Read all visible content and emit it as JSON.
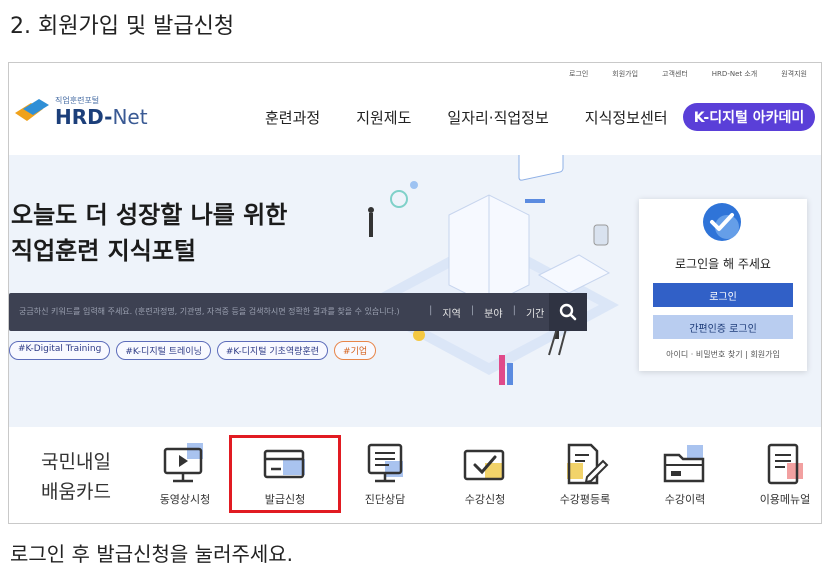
{
  "step_title": "2. 회원가입 및 발급신청",
  "caption": "로그인 후 발급신청을 눌러주세요.",
  "site": {
    "util_links": [
      "로그인",
      "회원가입",
      "고객센터",
      "HRD-Net 소개",
      "원격지원"
    ],
    "logo": {
      "sub": "직업훈련포털",
      "name": "HRD",
      "name_suffix": "Net"
    },
    "gnb": [
      "훈련과정",
      "지원제도",
      "일자리·직업정보",
      "지식정보센터"
    ],
    "kd_button": "K-디지털 아카데미"
  },
  "hero": {
    "line1": "오늘도 더 성장할 나를 위한",
    "line2": "직업훈련 지식포털",
    "search_placeholder": "궁금하신 키워드를 입력해 주세요. (훈련과정명, 기관명, 자격증 등을 검색하시면 정확한 결과를 찾을 수 있습니다.)",
    "filters": [
      "지역",
      "분야",
      "기간"
    ],
    "tags": [
      "#K-Digital Training",
      "#K-디지털 트레이닝",
      "#K-디지털 기초역량훈련",
      "#기업"
    ]
  },
  "login_box": {
    "message": "로그인을 해 주세요",
    "login_button": "로그인",
    "easy_login_button": "간편인증 로그인",
    "links": "아이디 · 비밀번호 찾기  |  회원가입"
  },
  "strip": {
    "card_label_line1": "국민내일",
    "card_label_line2": "배움카드",
    "services": [
      "동영상시청",
      "발급신청",
      "진단상담",
      "수강신청",
      "수강평등록",
      "수강이력",
      "이용메뉴얼"
    ]
  },
  "colors": {
    "accent": "#3160c7",
    "highlight": "#e11b22",
    "academy": "#5a3fd8"
  }
}
